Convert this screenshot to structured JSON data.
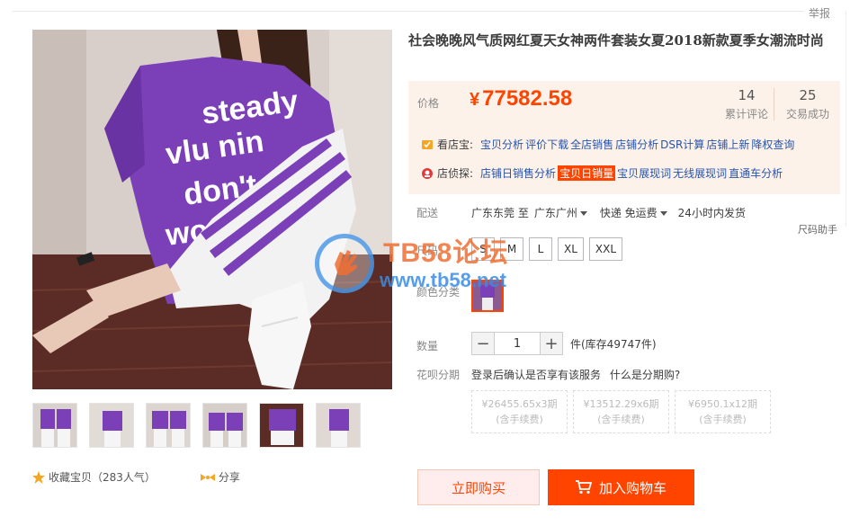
{
  "header": {
    "report_label": "举报"
  },
  "product": {
    "title": "社会晚晚风气质网红夏天女神两件套装女夏2018新款夏季女潮流时尚",
    "shirt_text": [
      "steady",
      "vlu nin",
      "don't",
      "worry"
    ]
  },
  "price_box": {
    "price_label": "价格",
    "currency": "¥",
    "price": "77582.58",
    "stats": [
      {
        "num": "14",
        "label": "累计评论"
      },
      {
        "num": "25",
        "label": "交易成功"
      }
    ],
    "tool_rows": [
      {
        "icon": "shop-check-icon",
        "heading": "看店宝:",
        "links": [
          "宝贝分析",
          "评价下载",
          "全店销售",
          "店铺分析",
          "DSR计算",
          "店铺上新",
          "降权查询"
        ],
        "highlight": -1
      },
      {
        "icon": "shop-detective-icon",
        "heading": "店侦探:",
        "links": [
          "店铺日销售分析",
          "宝贝日销量",
          "宝贝展现词",
          "无线展现词",
          "直通车分析"
        ],
        "highlight": 1
      }
    ]
  },
  "shipping": {
    "label": "配送",
    "from": "广东东莞 至",
    "to": "广东广州",
    "method": "快递 免运费",
    "time": "24小时内发货"
  },
  "size": {
    "label": "尺码",
    "helper": "尺码助手",
    "options": [
      "S",
      "M",
      "L",
      "XL",
      "XXL"
    ]
  },
  "color": {
    "label": "颜色分类"
  },
  "quantity": {
    "label": "数量",
    "minus": "−",
    "value": "1",
    "plus": "+",
    "stock": "件(库存49747件)"
  },
  "huabei": {
    "label": "花呗分期",
    "text": "登录后确认是否享有该服务",
    "what": "什么是分期购?",
    "options": [
      {
        "price": "¥26455.65x3期",
        "fee": "(含手续费)"
      },
      {
        "price": "¥13512.29x6期",
        "fee": "(含手续费)"
      },
      {
        "price": "¥6950.1x12期",
        "fee": "(含手续费)"
      }
    ]
  },
  "buttons": {
    "buy": "立即购买",
    "cart": "加入购物车"
  },
  "footer_actions": {
    "favorite": "收藏宝贝（283人气）",
    "share": "分享"
  },
  "watermark": {
    "line1": "TB58论坛",
    "line2": "www.tb58.net"
  },
  "colors": {
    "accent": "#ff4400",
    "price_bg": "#fdf2ea",
    "link": "#2953a6",
    "purple": "#7b3fb8"
  }
}
